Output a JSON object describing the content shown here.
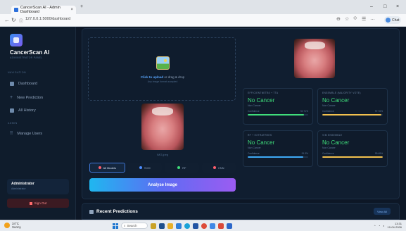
{
  "browser": {
    "tab_title": "CancerScan AI - Admin Dashboard",
    "tab_close": "×",
    "new_tab": "+",
    "url": "127.0.0.1:5000/dashboard",
    "minimize": "–",
    "maximize": "□",
    "close": "×",
    "profile_label": "Chat"
  },
  "sidebar": {
    "brand": "CancerScan AI",
    "brand_sub": "ADMINISTRATOR PANEL",
    "nav_section": "NAVIGATION",
    "items": [
      {
        "label": "Dashboard",
        "icon": "dashboard-icon"
      },
      {
        "label": "New Prediction",
        "icon": "plus-icon"
      },
      {
        "label": "All History",
        "icon": "history-icon"
      }
    ],
    "admin_section": "ADMIN",
    "admin_items": [
      {
        "label": "Manage Users",
        "icon": "users-icon"
      }
    ],
    "admin": {
      "name": "Administrator",
      "role": "Administrator"
    },
    "sign_out": "Sign Out"
  },
  "upload": {
    "click_text": "Click to upload",
    "or_text": " or drag & drop",
    "hint": "Any image format accepted",
    "preview_caption": "IMG.jpeg"
  },
  "models": [
    {
      "label": "All Models",
      "color": "#ff5f6d",
      "active": true
    },
    {
      "label": "SVM",
      "color": "#4c8dff",
      "active": false
    },
    {
      "label": "RF",
      "color": "#3fdc7a",
      "active": false
    },
    {
      "label": "CNN",
      "color": "#ff5f6d",
      "active": false
    }
  ],
  "analyse_label": "Analyse Image",
  "results": [
    {
      "title": "EFFICIENTNETB0 + TTA",
      "verdict": "No Cancer",
      "sub": "Non Cancer",
      "conf_label": "Confidence",
      "conf_value": "92.71%",
      "conf": 0.9271,
      "color": "#3fdc7a"
    },
    {
      "title": "ENSEMBLE (MAJORITY VOTE)",
      "verdict": "No Cancer",
      "sub": "Non Cancer",
      "conf_label": "Confidence",
      "conf_value": "97.76%",
      "conf": 0.9776,
      "color": "#f2c14e"
    },
    {
      "title": "RF + EXTRATREES",
      "verdict": "No Cancer",
      "sub": "Non Cancer",
      "conf_label": "Confidence",
      "conf_value": "91.3%",
      "conf": 0.913,
      "color": "#3fa9f5"
    },
    {
      "title": "VIM ENSEMBLE",
      "verdict": "No Cancer",
      "sub": "Non Cancer",
      "conf_label": "Confidence",
      "conf_value": "99.48%",
      "conf": 0.9948,
      "color": "#f2c14e"
    }
  ],
  "recent": {
    "title": "Recent Predictions",
    "view_all": "View All"
  },
  "taskbar": {
    "weather_temp": "34°C",
    "weather_desc": "Sunny",
    "search": "Search",
    "time": "13:31",
    "date": "10-04-2026"
  }
}
